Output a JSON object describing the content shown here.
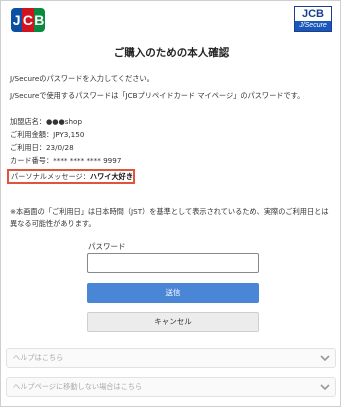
{
  "header": {
    "jcb_logo": [
      "J",
      "C",
      "B"
    ],
    "jsecure_top": "JCB",
    "jsecure_bottom": "J/Secure"
  },
  "title": "ご購入のための本人確認",
  "intro": [
    "J/Secureのパスワードを入力してください。",
    "J/Secureで使用するパスワードは「JCBプリペイドカード マイページ」のパスワードです。"
  ],
  "details": [
    "加盟店名：●●●shop",
    "ご利用金額：JPY3,150",
    "ご利用日：23/0/28",
    "カード番号：**** **** **** 9997"
  ],
  "personal_message": {
    "label": "パーソナルメッセージ：",
    "value": "ハワイ大好き"
  },
  "note": "※本画面の「ご利用日」は日本時間（JST）を基準として表示されているため、実際のご利用日とは異なる可能性があります。",
  "form": {
    "password_label": "パスワード",
    "password_value": "",
    "send_label": "送信",
    "cancel_label": "キャンセル"
  },
  "accordions": [
    "ヘルプはこちら",
    "ヘルプページに移動しない場合はこちら"
  ],
  "colors": {
    "accent": "#4a86d6",
    "highlight_border": "#e0533d",
    "jcb_blue": "#0b4fa3",
    "jcb_red": "#d1121f",
    "jcb_green": "#0a8a3e"
  }
}
